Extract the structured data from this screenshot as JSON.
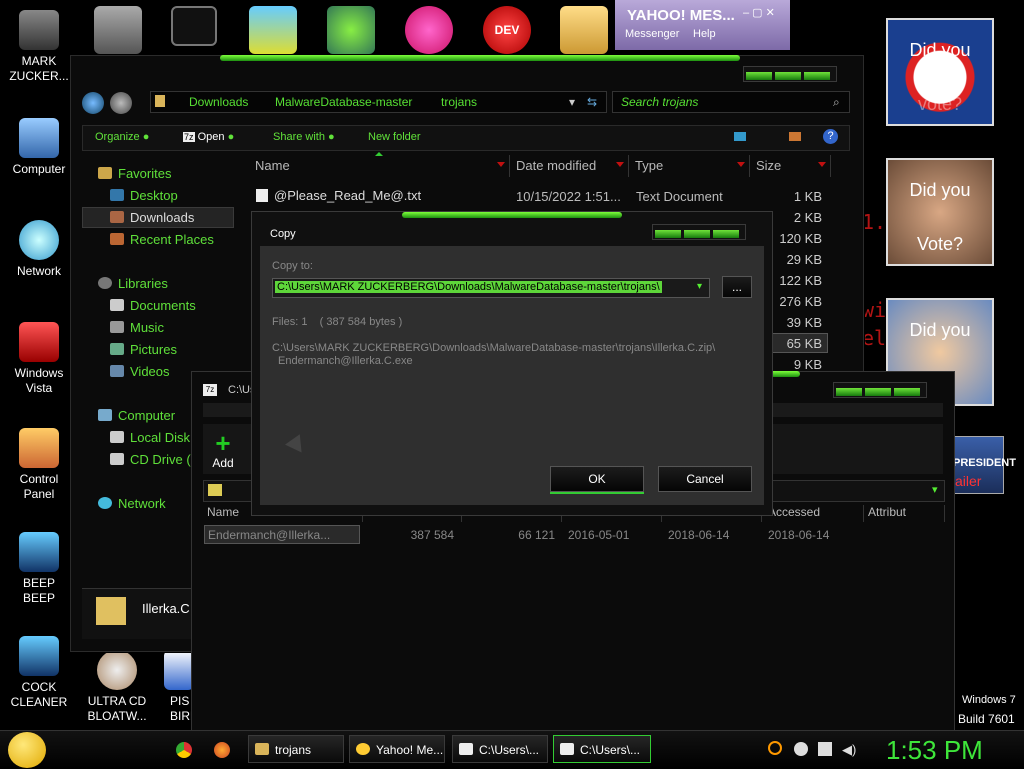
{
  "colors": {
    "accent_green": "#57e034",
    "desktop": "#000000",
    "red_text": "#b21414"
  },
  "desktop": {
    "icons": [
      {
        "label": "MARK ZUCKER...",
        "icon": "user-folder-icon"
      },
      {
        "label": "Computer",
        "icon": "computer-icon"
      },
      {
        "label": "Network",
        "icon": "network-icon"
      },
      {
        "label": "Windows Vista",
        "icon": "recycle-bin-icon"
      },
      {
        "label": "Control Panel",
        "icon": "control-panel-icon"
      },
      {
        "label": "BEEP BEEP",
        "icon": "beep-icon"
      },
      {
        "label": "COCK CLEANER",
        "icon": "cleaner-icon"
      },
      {
        "label": "ULTRA CD BLOATW...",
        "icon": "cd-icon"
      },
      {
        "label": "PIS BIRD",
        "icon": "bird-icon"
      }
    ],
    "top_apps": {
      "yahoo": {
        "title": "YAHOO! MES...",
        "menu1": "Messenger",
        "menu2": "Help"
      },
      "devcpp": "DEV C++"
    },
    "posters": [
      {
        "top": "Did you",
        "bottom": "vote?"
      },
      {
        "top": "Did you",
        "bottom": "Vote?"
      },
      {
        "top": "Did you",
        "bottom": "?"
      }
    ],
    "president_label": "PRESIDENT",
    "mailer_label": "ailer",
    "watermark": {
      "os": "Windows 7",
      "build": "Build 7601"
    }
  },
  "explorer": {
    "breadcrumb": [
      "Downloads",
      "MalwareDatabase-master",
      "trojans"
    ],
    "search_placeholder": "Search trojans",
    "toolbar": {
      "organize": "Organize",
      "open": "Open",
      "share": "Share with",
      "new_folder": "New folder"
    },
    "nav": {
      "favorites": "Favorites",
      "desktop": "Desktop",
      "downloads": "Downloads",
      "recent": "Recent Places",
      "libraries": "Libraries",
      "documents": "Documents",
      "music": "Music",
      "pictures": "Pictures",
      "videos": "Videos",
      "computer": "Computer",
      "local_disk": "Local Disk",
      "cd_drive": "CD Drive (E",
      "network": "Network"
    },
    "columns": {
      "name": "Name",
      "date": "Date modified",
      "type": "Type",
      "size": "Size"
    },
    "first_file": {
      "name": "@Please_Read_Me@.txt",
      "date": "10/15/2022 1:51...",
      "type": "Text Document",
      "size": "1 KB"
    },
    "sizes": [
      "2 KB",
      "120 KB",
      "29 KB",
      "122 KB",
      "276 KB",
      "39 KB",
      "65 KB",
      "9 KB"
    ],
    "details_file": "Illerka.C"
  },
  "copy_dialog": {
    "title": "Copy",
    "copy_to_label": "Copy to:",
    "path": "C:\\Users\\MARK ZUCKERBERG\\Downloads\\MalwareDatabase-master\\trojans\\",
    "browse_label": "...",
    "files_info": "Files: 1    ( 387 584 bytes )",
    "source_line1": "C:\\Users\\MARK ZUCKERBERG\\Downloads\\MalwareDatabase-master\\trojans\\Illerka.C.zip\\",
    "source_line2": "Endermanch@Illerka.C.exe",
    "ok": "OK",
    "cancel": "Cancel"
  },
  "sevenzip": {
    "title": "C:\\Us",
    "add_label": "Add",
    "columns": [
      "Name",
      "Size",
      "Packed Size",
      "Modified",
      "Created",
      "Accessed",
      "Attribut"
    ],
    "row": {
      "name": "Endermanch@Illerka...",
      "size": "387 584",
      "packed": "66 121",
      "modified": "2016-05-01",
      "created": "2018-06-14",
      "accessed": "2018-06-14"
    }
  },
  "taskbar": {
    "buttons": [
      "trojans",
      "Yahoo! Me...",
      "C:\\Users\\...",
      "C:\\Users\\..."
    ],
    "clock": "1:53 PM"
  }
}
